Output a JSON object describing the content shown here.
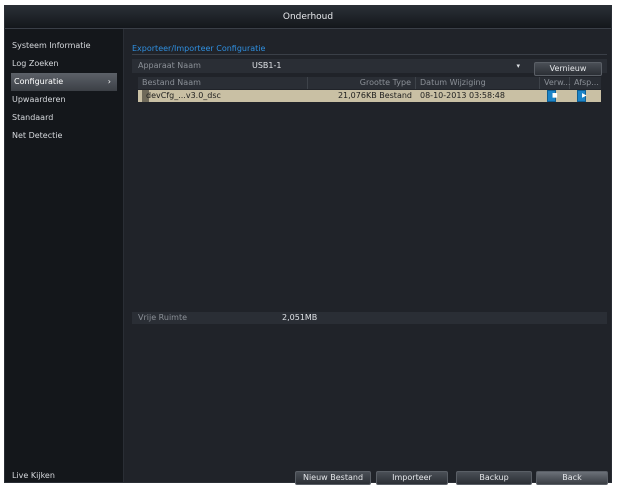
{
  "window": {
    "title": "Onderhoud"
  },
  "sidebar": {
    "items": [
      {
        "label": "Systeem Informatie",
        "active": false
      },
      {
        "label": "Log Zoeken",
        "active": false
      },
      {
        "label": "Configuratie",
        "active": true,
        "arrow": "›"
      },
      {
        "label": "Upwaarderen",
        "active": false
      },
      {
        "label": "Standaard",
        "active": false
      },
      {
        "label": "Net Detectie",
        "active": false
      }
    ],
    "bottom_label": "Live Kijken"
  },
  "main": {
    "section_title": "Exporteer/Importeer Configuratie",
    "device": {
      "label": "Apparaat Naam",
      "value": "USB1-1",
      "refresh_label": "Vernieuw"
    },
    "table": {
      "headers": [
        "Bestand Naam",
        "Grootte Type",
        "Datum Wijziging",
        "Verw...",
        "Afsp..."
      ],
      "rows": [
        {
          "name": "devCfg_...v3.0_dsc",
          "size": "21,076KB Bestand",
          "date": "08-10-2013 03:58:48"
        }
      ]
    },
    "free_space": {
      "label": "Vrije Ruimte",
      "value": "2,051MB"
    }
  },
  "footer": {
    "buttons": [
      "Nieuw Bestand",
      "Importeer",
      "Backup",
      "Back"
    ]
  },
  "colors": {
    "accent": "#2f8fe0",
    "selected_row": "#c9c0a4",
    "icon_blue": "#1c84c8"
  }
}
